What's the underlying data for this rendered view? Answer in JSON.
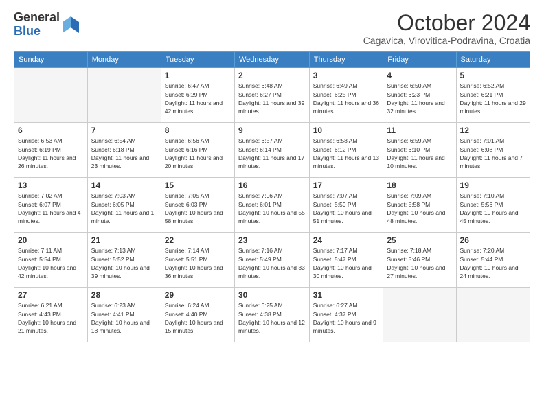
{
  "header": {
    "logo_line1": "General",
    "logo_line2": "Blue",
    "month": "October 2024",
    "location": "Cagavica, Virovitica-Podravina, Croatia"
  },
  "weekdays": [
    "Sunday",
    "Monday",
    "Tuesday",
    "Wednesday",
    "Thursday",
    "Friday",
    "Saturday"
  ],
  "weeks": [
    [
      {
        "day": "",
        "info": ""
      },
      {
        "day": "",
        "info": ""
      },
      {
        "day": "1",
        "info": "Sunrise: 6:47 AM\nSunset: 6:29 PM\nDaylight: 11 hours and 42 minutes."
      },
      {
        "day": "2",
        "info": "Sunrise: 6:48 AM\nSunset: 6:27 PM\nDaylight: 11 hours and 39 minutes."
      },
      {
        "day": "3",
        "info": "Sunrise: 6:49 AM\nSunset: 6:25 PM\nDaylight: 11 hours and 36 minutes."
      },
      {
        "day": "4",
        "info": "Sunrise: 6:50 AM\nSunset: 6:23 PM\nDaylight: 11 hours and 32 minutes."
      },
      {
        "day": "5",
        "info": "Sunrise: 6:52 AM\nSunset: 6:21 PM\nDaylight: 11 hours and 29 minutes."
      }
    ],
    [
      {
        "day": "6",
        "info": "Sunrise: 6:53 AM\nSunset: 6:19 PM\nDaylight: 11 hours and 26 minutes."
      },
      {
        "day": "7",
        "info": "Sunrise: 6:54 AM\nSunset: 6:18 PM\nDaylight: 11 hours and 23 minutes."
      },
      {
        "day": "8",
        "info": "Sunrise: 6:56 AM\nSunset: 6:16 PM\nDaylight: 11 hours and 20 minutes."
      },
      {
        "day": "9",
        "info": "Sunrise: 6:57 AM\nSunset: 6:14 PM\nDaylight: 11 hours and 17 minutes."
      },
      {
        "day": "10",
        "info": "Sunrise: 6:58 AM\nSunset: 6:12 PM\nDaylight: 11 hours and 13 minutes."
      },
      {
        "day": "11",
        "info": "Sunrise: 6:59 AM\nSunset: 6:10 PM\nDaylight: 11 hours and 10 minutes."
      },
      {
        "day": "12",
        "info": "Sunrise: 7:01 AM\nSunset: 6:08 PM\nDaylight: 11 hours and 7 minutes."
      }
    ],
    [
      {
        "day": "13",
        "info": "Sunrise: 7:02 AM\nSunset: 6:07 PM\nDaylight: 11 hours and 4 minutes."
      },
      {
        "day": "14",
        "info": "Sunrise: 7:03 AM\nSunset: 6:05 PM\nDaylight: 11 hours and 1 minute."
      },
      {
        "day": "15",
        "info": "Sunrise: 7:05 AM\nSunset: 6:03 PM\nDaylight: 10 hours and 58 minutes."
      },
      {
        "day": "16",
        "info": "Sunrise: 7:06 AM\nSunset: 6:01 PM\nDaylight: 10 hours and 55 minutes."
      },
      {
        "day": "17",
        "info": "Sunrise: 7:07 AM\nSunset: 5:59 PM\nDaylight: 10 hours and 51 minutes."
      },
      {
        "day": "18",
        "info": "Sunrise: 7:09 AM\nSunset: 5:58 PM\nDaylight: 10 hours and 48 minutes."
      },
      {
        "day": "19",
        "info": "Sunrise: 7:10 AM\nSunset: 5:56 PM\nDaylight: 10 hours and 45 minutes."
      }
    ],
    [
      {
        "day": "20",
        "info": "Sunrise: 7:11 AM\nSunset: 5:54 PM\nDaylight: 10 hours and 42 minutes."
      },
      {
        "day": "21",
        "info": "Sunrise: 7:13 AM\nSunset: 5:52 PM\nDaylight: 10 hours and 39 minutes."
      },
      {
        "day": "22",
        "info": "Sunrise: 7:14 AM\nSunset: 5:51 PM\nDaylight: 10 hours and 36 minutes."
      },
      {
        "day": "23",
        "info": "Sunrise: 7:16 AM\nSunset: 5:49 PM\nDaylight: 10 hours and 33 minutes."
      },
      {
        "day": "24",
        "info": "Sunrise: 7:17 AM\nSunset: 5:47 PM\nDaylight: 10 hours and 30 minutes."
      },
      {
        "day": "25",
        "info": "Sunrise: 7:18 AM\nSunset: 5:46 PM\nDaylight: 10 hours and 27 minutes."
      },
      {
        "day": "26",
        "info": "Sunrise: 7:20 AM\nSunset: 5:44 PM\nDaylight: 10 hours and 24 minutes."
      }
    ],
    [
      {
        "day": "27",
        "info": "Sunrise: 6:21 AM\nSunset: 4:43 PM\nDaylight: 10 hours and 21 minutes."
      },
      {
        "day": "28",
        "info": "Sunrise: 6:23 AM\nSunset: 4:41 PM\nDaylight: 10 hours and 18 minutes."
      },
      {
        "day": "29",
        "info": "Sunrise: 6:24 AM\nSunset: 4:40 PM\nDaylight: 10 hours and 15 minutes."
      },
      {
        "day": "30",
        "info": "Sunrise: 6:25 AM\nSunset: 4:38 PM\nDaylight: 10 hours and 12 minutes."
      },
      {
        "day": "31",
        "info": "Sunrise: 6:27 AM\nSunset: 4:37 PM\nDaylight: 10 hours and 9 minutes."
      },
      {
        "day": "",
        "info": ""
      },
      {
        "day": "",
        "info": ""
      }
    ]
  ]
}
